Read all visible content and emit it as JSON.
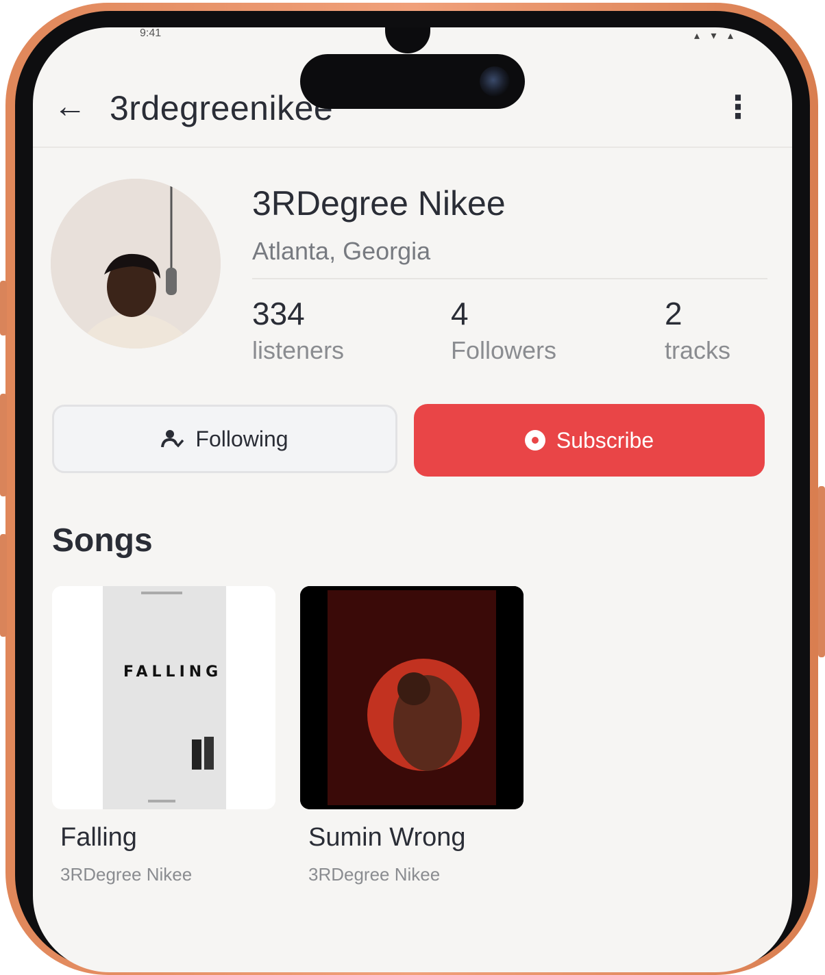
{
  "status_bar": {
    "time": "9:41",
    "icons": "▴ ▾ ▴"
  },
  "header": {
    "back_icon": "arrow-left-icon",
    "handle": "3rdegreenikee",
    "more_icon": "more-vertical-icon"
  },
  "profile": {
    "name": "3RDegree Nikee",
    "location": "Atlanta, Georgia",
    "stats": [
      {
        "value": "334",
        "label": "listeners"
      },
      {
        "value": "4",
        "label": "Followers"
      },
      {
        "value": "2",
        "label": "tracks"
      }
    ]
  },
  "actions": {
    "following_label": "Following",
    "following_icon": "person-check-icon",
    "subscribe_label": "Subscribe",
    "subscribe_icon": "record-circle-icon"
  },
  "songs": {
    "title": "Songs",
    "items": [
      {
        "title": "Falling",
        "artist": "3RDegree Nikee",
        "cover_text": "FALLING"
      },
      {
        "title": "Sumin Wrong",
        "artist": "3RDegree Nikee"
      }
    ]
  },
  "colors": {
    "accent": "#e94547",
    "frame": "#e8926a",
    "background": "#f6f5f3"
  }
}
